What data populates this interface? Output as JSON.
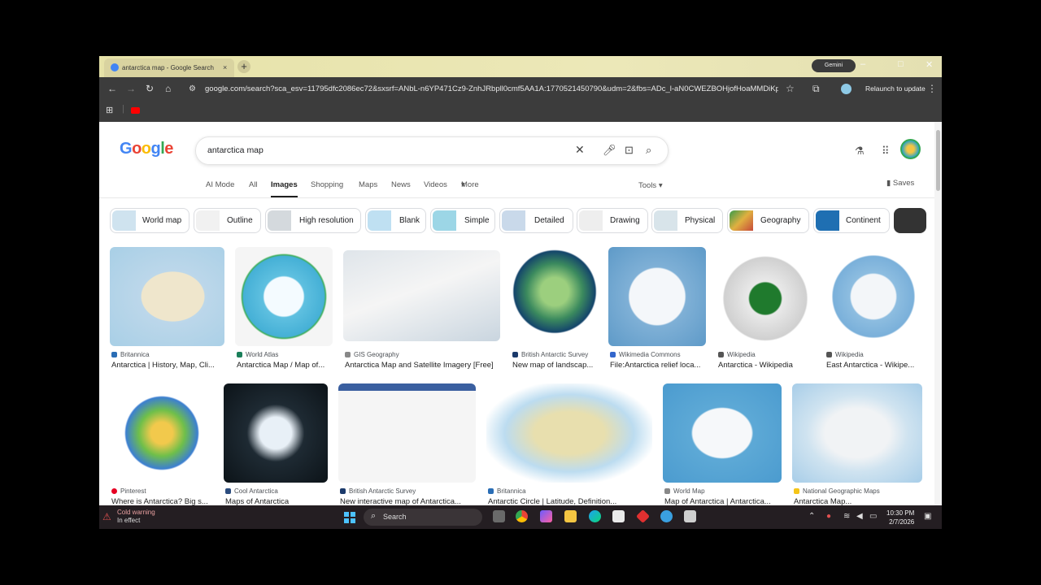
{
  "browser": {
    "tab_title": "antarctica map - Google Search",
    "tab_close": "×",
    "new_tab": "+",
    "gemini_label": "Gemini",
    "url": "google.com/search?sca_esv=11795dfc2086ec72&sxsrf=ANbL-n6YP471Cz9-ZnhJRbpll0cmf5AA1A:1770521450790&udm=2&fbs=ADc_l-aN0CWEZBOHjofHoaMMDiKpa...",
    "relaunch_label": "Relaunch to update",
    "icons": [
      "back-icon",
      "forward-icon",
      "reload-icon",
      "home-icon",
      "site-info-icon",
      "star-icon",
      "extensions-icon",
      "profile-icon",
      "menu-icon",
      "apps-icon",
      "youtube-icon"
    ]
  },
  "google": {
    "logo": "Google",
    "query": "antarctica map",
    "nav_tabs": [
      "AI Mode",
      "All",
      "Images",
      "Shopping",
      "Maps",
      "News",
      "Videos",
      "More"
    ],
    "tools_label": "Tools",
    "saves_label": "Saves",
    "chips": [
      "World map",
      "Outline",
      "High resolution",
      "Blank",
      "Simple",
      "Detailed",
      "Drawing",
      "Physical",
      "Geography",
      "Continent"
    ]
  },
  "results": [
    {
      "source": "Britannica",
      "title": "Antarctica | History, Map, Cli...",
      "color": "#2a6db5"
    },
    {
      "source": "World Atlas",
      "title": "Antarctica Map / Map of...",
      "color": "#1a7f5a"
    },
    {
      "source": "GIS Geography",
      "title": "Antarctica Map and Satellite Imagery [Free]",
      "color": "#888888"
    },
    {
      "source": "British Antarctic Survey",
      "title": "New map of landscap...",
      "color": "#1b3a6b"
    },
    {
      "source": "Wikimedia Commons",
      "title": "File:Antarctica relief loca...",
      "color": "#3366cc"
    },
    {
      "source": "Wikipedia",
      "title": "Antarctica - Wikipedia",
      "color": "#555555"
    },
    {
      "source": "Wikipedia",
      "title": "East Antarctica - Wikipe...",
      "color": "#555555"
    },
    {
      "source": "Pinterest",
      "title": "Where is Antarctica? Big s...",
      "color": "#e60023"
    },
    {
      "source": "Cool Antarctica",
      "title": "Maps of Antarctica",
      "color": "#2b4c7e"
    },
    {
      "source": "British Antarctic Survey",
      "title": "New interactive map of Antarctica...",
      "color": "#1b3a6b"
    },
    {
      "source": "Britannica",
      "title": "Antarctic Circle | Latitude, Definition...",
      "color": "#2a6db5"
    },
    {
      "source": "World Map",
      "title": "Map of Antarctica | Antarctica...",
      "color": "#888888"
    },
    {
      "source": "National Geographic Maps",
      "title": "Antarctica Map...",
      "color": "#f5c518"
    }
  ],
  "taskbar": {
    "weather_title": "Cold warning",
    "weather_sub": "In effect",
    "search_label": "Search",
    "time": "10:30 PM",
    "date": "2/7/2026"
  }
}
